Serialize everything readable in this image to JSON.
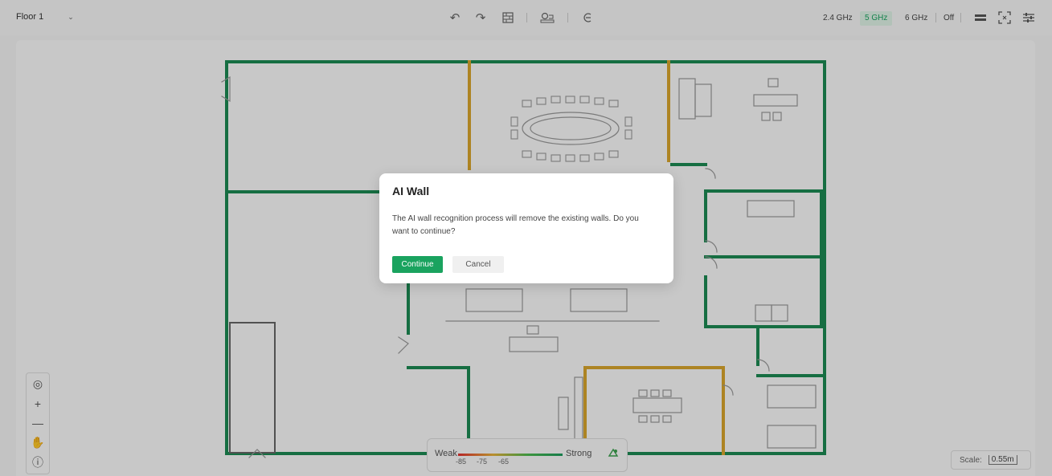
{
  "toolbar": {
    "floor_label": "Floor 1",
    "bands": [
      "2.4 GHz",
      "5 GHz",
      "6 GHz",
      "Off"
    ],
    "active_band": "5 GHz",
    "icons": [
      "undo-icon",
      "redo-icon",
      "wall-icon",
      "ap-icon",
      "ai-wall-icon",
      "layers-icon",
      "fit-screen-icon",
      "settings-icon"
    ]
  },
  "legend": {
    "weak": "Weak",
    "strong": "Strong",
    "ticks": [
      "-85",
      "-75",
      "-65"
    ]
  },
  "scale": {
    "label": "Scale:",
    "value": "0.55m"
  },
  "dialog": {
    "title": "AI Wall",
    "message": "The AI wall recognition process will remove the existing walls. Do you want to continue?",
    "confirm_label": "Continue",
    "cancel_label": "Cancel"
  },
  "colors": {
    "accent": "#1aa35f",
    "wall_concrete": "#1c8a53",
    "wall_glass": "#d9a62c"
  }
}
